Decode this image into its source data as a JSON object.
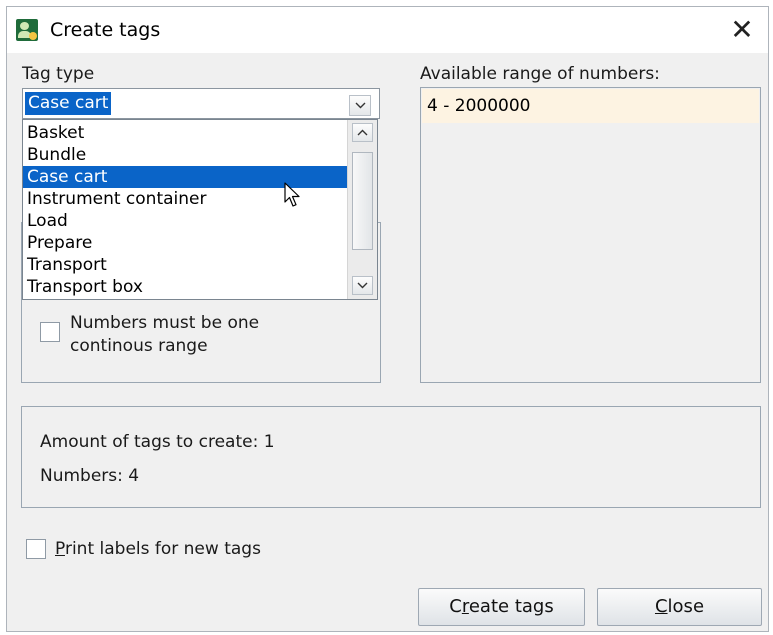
{
  "window": {
    "title": "Create tags"
  },
  "tag_type": {
    "label": "Tag type",
    "selected": "Case cart",
    "options": [
      "Basket",
      "Bundle",
      "Case cart",
      "Instrument container",
      "Load",
      "Prepare",
      "Transport",
      "Transport box"
    ],
    "selected_index": 2
  },
  "range": {
    "label": "Available range of numbers:",
    "values": [
      "4 - 2000000"
    ]
  },
  "continuous": {
    "label_line1": "Numbers must be one",
    "label_line2": "continous range",
    "checked": false
  },
  "summary": {
    "amount_label": "Amount of tags to create: 1",
    "numbers_label": "Numbers:  4"
  },
  "print_labels": {
    "mnemonic": "P",
    "rest": "rint labels for new tags",
    "checked": false
  },
  "buttons": {
    "create": {
      "before": "C",
      "mnemonic": "r",
      "after": "eate tags"
    },
    "close": {
      "mnemonic": "C",
      "after": "lose"
    }
  },
  "colors": {
    "selection": "#0a64c8",
    "range_row_bg": "#fdf3e2",
    "dialog_bg": "#f0f0f0"
  },
  "icons": [
    "app-icon",
    "close-icon",
    "chevron-down-icon",
    "chevron-up-icon",
    "mouse-cursor-icon"
  ]
}
